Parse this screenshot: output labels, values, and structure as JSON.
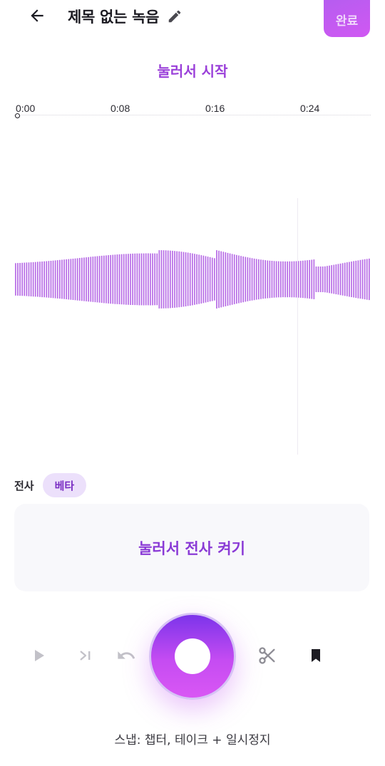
{
  "header": {
    "title": "제목 없는 녹음",
    "done_label": "완료"
  },
  "tap_to_start": "눌러서 시작",
  "timeline": {
    "ticks": [
      "0:00",
      "0:08",
      "0:16",
      "0:24"
    ]
  },
  "transcript": {
    "label": "전사",
    "badge": "베타",
    "cta": "눌러서 전사 켜기"
  },
  "hint": "스냅: 챕터, 테이크 + 일시정지",
  "colors": {
    "accent": "#9a3fd9",
    "waveform": "#b76be6",
    "record_top": "#7c34ea",
    "record_bottom": "#d957f4"
  },
  "icons": {
    "back": "arrow-left-icon",
    "edit": "pencil-icon",
    "play": "play-icon",
    "skip": "skip-next-icon",
    "undo": "undo-icon",
    "cut": "scissors-icon",
    "bookmark": "bookmark-icon"
  }
}
